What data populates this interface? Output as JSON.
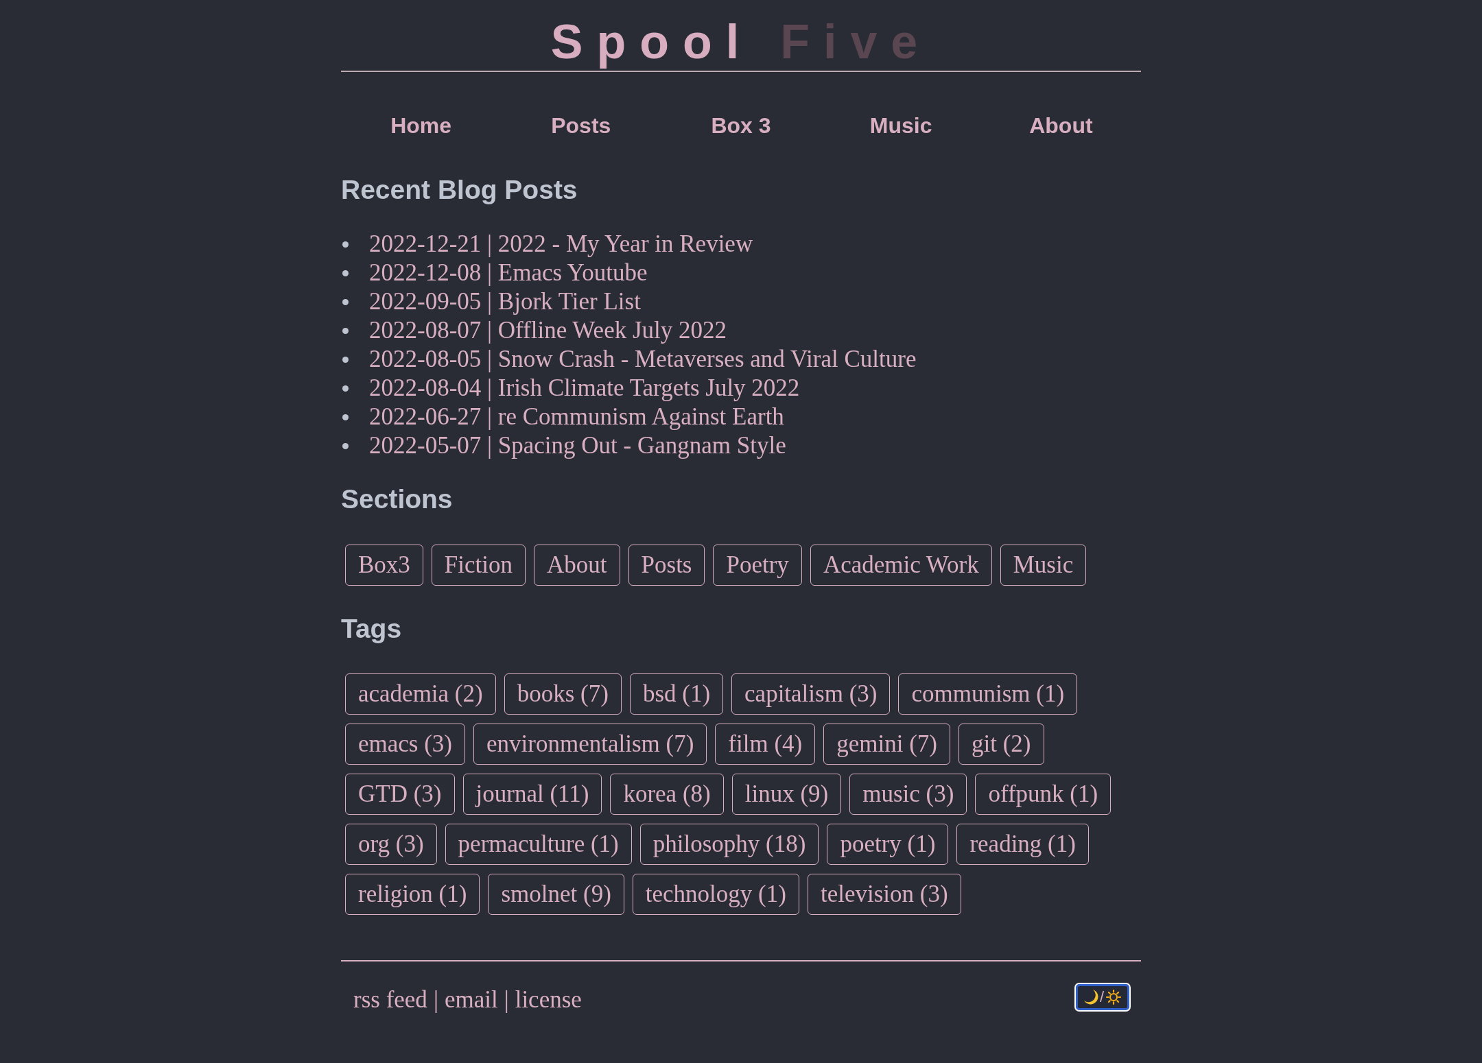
{
  "site_title": [
    {
      "text": "Spool",
      "color": "#d7adbf"
    },
    {
      "text": "Five",
      "color": "#5a4650"
    }
  ],
  "nav": [
    "Home",
    "Posts",
    "Box 3",
    "Music",
    "About"
  ],
  "recent_posts": {
    "heading": "Recent Blog Posts",
    "items": [
      "2022-12-21 | 2022 - My Year in Review",
      "2022-12-08 | Emacs Youtube",
      "2022-09-05 | Bjork Tier List",
      "2022-08-07 | Offline Week July 2022",
      "2022-08-05 | Snow Crash - Metaverses and Viral Culture",
      "2022-08-04 | Irish Climate Targets July 2022",
      "2022-06-27 | re Communism Against Earth",
      "2022-05-07 | Spacing Out - Gangnam Style"
    ]
  },
  "sections": {
    "heading": "Sections",
    "items": [
      "Box3",
      "Fiction",
      "About",
      "Posts",
      "Poetry",
      "Academic Work",
      "Music"
    ]
  },
  "tags": {
    "heading": "Tags",
    "items": [
      "academia (2)",
      "books (7)",
      "bsd (1)",
      "capitalism (3)",
      "communism (1)",
      "emacs (3)",
      "environmentalism (7)",
      "film (4)",
      "gemini (7)",
      "git (2)",
      "GTD (3)",
      "journal (11)",
      "korea (8)",
      "linux (9)",
      "music (3)",
      "offpunk (1)",
      "org (3)",
      "permaculture (1)",
      "philosophy (18)",
      "poetry (1)",
      "reading (1)",
      "religion (1)",
      "smolnet (9)",
      "technology (1)",
      "television (3)"
    ]
  },
  "footer": {
    "links": [
      "rss feed",
      "email",
      "license"
    ],
    "separators": [
      "|",
      "|"
    ],
    "theme_toggle": {
      "label": "/"
    }
  }
}
